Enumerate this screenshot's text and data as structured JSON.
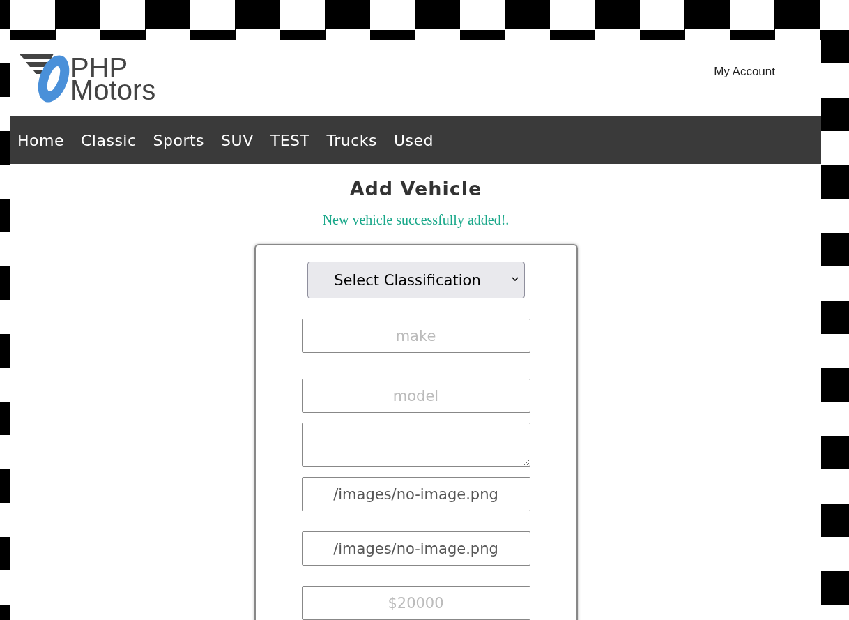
{
  "header": {
    "logo_lines": [
      "PHP",
      "Motors"
    ],
    "account_link": "My Account"
  },
  "nav": {
    "items": [
      {
        "label": "Home"
      },
      {
        "label": "Classic"
      },
      {
        "label": "Sports"
      },
      {
        "label": "SUV"
      },
      {
        "label": "TEST"
      },
      {
        "label": "Trucks"
      },
      {
        "label": "Used"
      }
    ]
  },
  "page": {
    "title": "Add Vehicle",
    "message": "New vehicle successfully added!."
  },
  "form": {
    "classification_select": {
      "value": "Select Classification"
    },
    "fields": [
      {
        "kind": "input",
        "placeholder": "make"
      },
      {
        "kind": "input",
        "placeholder": "model"
      },
      {
        "kind": "textarea"
      },
      {
        "kind": "input",
        "value": "/images/no-image.png"
      },
      {
        "kind": "input",
        "value": "/images/no-image.png"
      },
      {
        "kind": "input",
        "placeholder": "$20000"
      }
    ]
  }
}
